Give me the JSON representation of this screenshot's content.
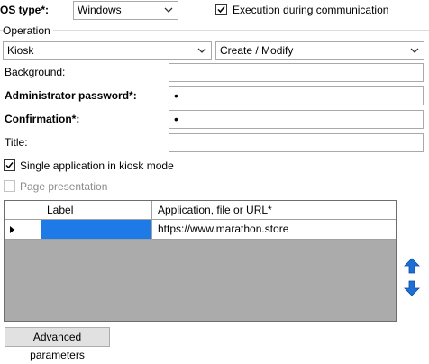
{
  "os_type": {
    "label": "OS type*:",
    "value": "Windows"
  },
  "execution": {
    "label": "Execution during communication",
    "checked": true
  },
  "operation": {
    "group_label": "Operation",
    "mode": "Kiosk",
    "action": "Create / Modify"
  },
  "fields": {
    "background_label": "Background:",
    "background_value": "",
    "admin_password_label": "Administrator password*:",
    "admin_password_value": "•",
    "confirmation_label": "Confirmation*:",
    "confirmation_value": "•",
    "title_label": "Title:",
    "title_value": ""
  },
  "single_app": {
    "label": "Single application in kiosk mode",
    "checked": true
  },
  "page_presentation": {
    "label": "Page presentation",
    "checked": false,
    "enabled": false
  },
  "grid": {
    "columns": [
      "Label",
      "Application, file or URL*"
    ],
    "rows": [
      {
        "label": "",
        "url": "https://www.marathon.store"
      }
    ]
  },
  "buttons": {
    "advanced": "Advanced parameters"
  },
  "colors": {
    "selection": "#1e7ae6",
    "arrow": "#1d6fd6",
    "grid_bg": "#ababab"
  }
}
